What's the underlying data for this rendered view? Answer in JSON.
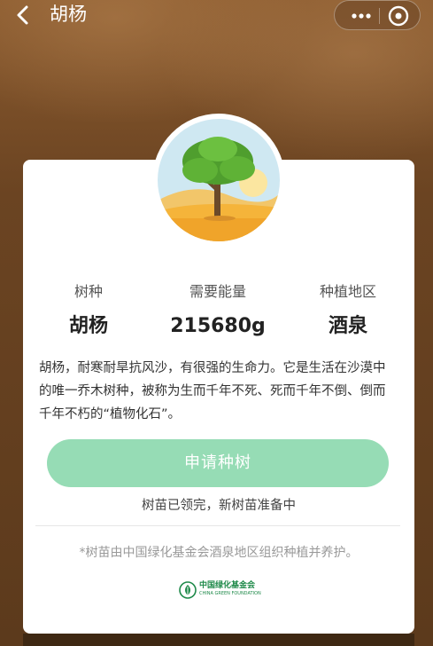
{
  "nav": {
    "title": "胡杨",
    "icons": [
      "back-arrow-icon",
      "more-icon",
      "close-circle-icon"
    ]
  },
  "tree": {
    "stats": [
      {
        "label": "树种",
        "value": "胡杨"
      },
      {
        "label": "需要能量",
        "value": "215680g"
      },
      {
        "label": "种植地区",
        "value": "酒泉"
      }
    ],
    "description": "胡杨，耐寒耐旱抗风沙，有很强的生命力。它是生活在沙漠中的唯一乔木树种，被称为生而千年不死、死而千年不倒、倒而千年不朽的“植物化石”。"
  },
  "actions": {
    "apply_label": "申请种树",
    "status": "树苗已领完，新树苗准备中"
  },
  "footer": {
    "note": "*树苗由中国绿化基金会酒泉地区组织种植并养护。",
    "logo_cn": "中国绿化基金会",
    "logo_en": "CHINA GREEN FOUNDATION"
  },
  "colors": {
    "background": "#6b4422",
    "button": "#96dcb5",
    "logo_green": "#1f8a4a"
  }
}
